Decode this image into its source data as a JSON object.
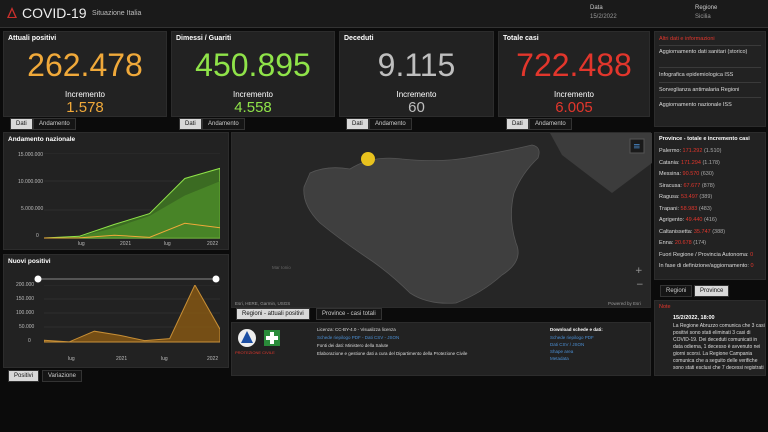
{
  "header": {
    "title": "COVID-19",
    "subtitle": "Situazione Italia",
    "date_label": "Data",
    "date_value": "15/2/2022",
    "region_label": "Regione",
    "region_value": "Sicilia"
  },
  "kpis": [
    {
      "title": "Attuali positivi",
      "value": "262.478",
      "inc_label": "Incremento",
      "inc_value": "1.578",
      "color": "#f0a93a",
      "tabs": [
        "Dati",
        "Andamento"
      ]
    },
    {
      "title": "Dimessi / Guariti",
      "value": "450.895",
      "inc_label": "Incremento",
      "inc_value": "4.558",
      "color": "#8fe349",
      "tabs": [
        "Dati",
        "Andamento"
      ]
    },
    {
      "title": "Deceduti",
      "value": "9.115",
      "inc_label": "Incremento",
      "inc_value": "60",
      "color": "#bfbfbf",
      "tabs": [
        "Dati",
        "Andamento"
      ]
    },
    {
      "title": "Totale casi",
      "value": "722.488",
      "inc_label": "Incremento",
      "inc_value": "6.005",
      "color": "#e2362c",
      "tabs": [
        "Dati",
        "Andamento"
      ]
    }
  ],
  "info": {
    "title": "Altri dati e informazioni",
    "items": [
      "Aggiornamento dati sanitari (storico)",
      "Infografica epidemiologica ISS",
      "Sorveglianza antimalaria Regioni",
      "Aggiornamento nazionale ISS"
    ]
  },
  "chart_andamento": {
    "title": "Andamento nazionale",
    "yticks": [
      "15.000.000",
      "10.000.000",
      "5.000.000",
      "0"
    ],
    "xticks": [
      "lug",
      "2021",
      "lug",
      "2022"
    ]
  },
  "chart_nuovi": {
    "title": "Nuovi positivi",
    "yticks": [
      "200.000",
      "150.000",
      "100.000",
      "50.000",
      "0"
    ],
    "xticks": [
      "lug",
      "2021",
      "lug",
      "2022"
    ],
    "tabs": [
      "Positivi",
      "Variazione"
    ]
  },
  "map": {
    "attribution": "Esri, HERE, Garmin, USGS",
    "powered": "Powered by Esri",
    "sea_label": "Mar Ionio",
    "tabs": [
      "Regioni - attuali positivi",
      "Province - casi totali"
    ],
    "region_color": "#3f3f3f",
    "marker_color": "#e8c21e"
  },
  "sources": {
    "org_label": "PROTEZIONE CIVILE",
    "licenza": "Licenza: CC-BY-4.0 - Visualizza licenza",
    "dati_link": "Schede riepilogo PDF - Dati CSV - JSON",
    "sorgente": "Fonti dei dati: Ministero della Salute",
    "elaborazione": "Elaborazione e gestione dati a cura del Dipartimento della Protezione Civile",
    "download_title": "Download schede e dati:",
    "download_items": [
      "Schede riepilogo PDF",
      "Dati CSV / JSON",
      "Shape area",
      "Metadata"
    ]
  },
  "province": {
    "title": "Province - totale e incremento casi",
    "rows": [
      {
        "name": "Palermo:",
        "num": "171.292",
        "inc": "(1.510)"
      },
      {
        "name": "Catania:",
        "num": "171.294",
        "inc": "(1.178)"
      },
      {
        "name": "Messina:",
        "num": "90.570",
        "inc": "(630)"
      },
      {
        "name": "Siracusa:",
        "num": "67.677",
        "inc": "(878)"
      },
      {
        "name": "Ragusa:",
        "num": "53.497",
        "inc": "(389)"
      },
      {
        "name": "Trapani:",
        "num": "58.983",
        "inc": "(483)"
      },
      {
        "name": "Agrigento:",
        "num": "49.440",
        "inc": "(416)"
      },
      {
        "name": "Caltanissetta:",
        "num": "35.747",
        "inc": "(388)"
      },
      {
        "name": "Enna:",
        "num": "20.678",
        "inc": "(174)"
      },
      {
        "name": "Fuori Regione / Provincia Autonoma:",
        "num": "0",
        "inc": ""
      },
      {
        "name": "In fase di definizione/aggiornamento:",
        "num": "0",
        "inc": ""
      }
    ],
    "tabs": [
      "Regioni",
      "Province"
    ]
  },
  "news": {
    "title": "Note",
    "date": "15/2/2022, 18:00",
    "text": "La Regione Abruzzo comunica che 3 casi positivi sono stati eliminati 3 casi di COVID-19. Dei deceduti comunicati in data odierna, 1 decesso è avvenuto nei giorni scorsi. La Regione Campania comunica che a seguito delle verifiche sono stati esclusi che 7 decessi registrati"
  },
  "chart_data": [
    {
      "type": "area",
      "title": "Andamento nazionale",
      "x": [
        "2020-03",
        "2020-07",
        "2021-01",
        "2021-07",
        "2022-01",
        "2022-02"
      ],
      "series": [],
      "values_total": [
        0,
        300000,
        2400000,
        4300000,
        10500000,
        12300000
      ],
      "values_guariti": [
        0,
        200000,
        1800000,
        3900000,
        7500000,
        10000000
      ],
      "values_positivi": [
        0,
        20000,
        500000,
        100000,
        2600000,
        1800000
      ],
      "ylim": [
        0,
        15000000
      ]
    },
    {
      "type": "line",
      "title": "Nuovi positivi",
      "x": [
        "2020-03",
        "2020-07",
        "2020-11",
        "2021-03",
        "2021-07",
        "2021-11",
        "2022-01",
        "2022-02"
      ],
      "values": [
        6000,
        300,
        38000,
        24000,
        5000,
        12000,
        200000,
        45000
      ],
      "ylim": [
        0,
        200000
      ]
    }
  ]
}
